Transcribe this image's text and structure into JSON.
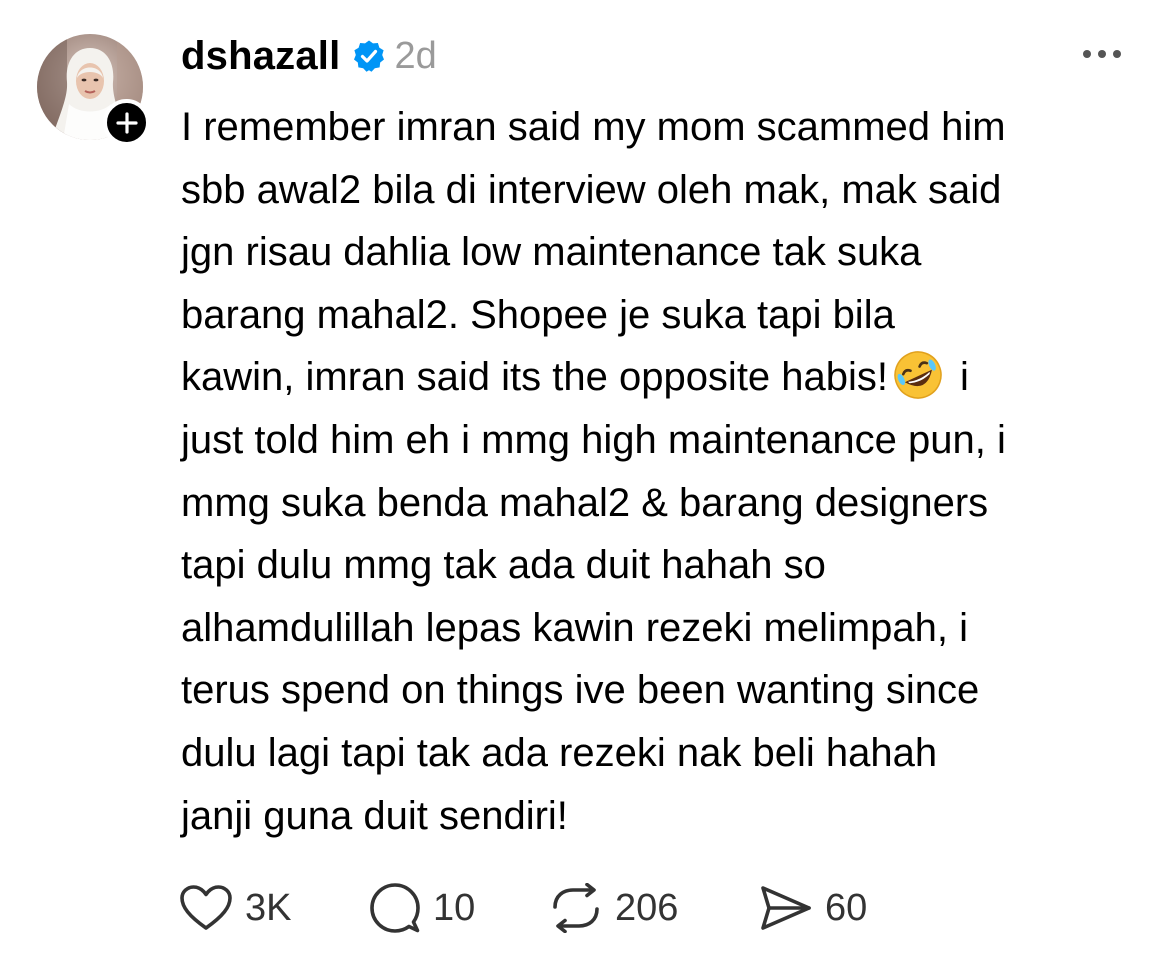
{
  "post": {
    "username": "dshazall",
    "time": "2d",
    "more_icon": "more-horizontal-icon",
    "verified_icon": "verified-badge-icon",
    "follow_icon": "plus-icon",
    "body_lines": [
      "I remember imran said my mom scammed him",
      "sbb awal2 bila di interview oleh mak, mak said",
      "jgn risau dahlia low maintenance tak suka",
      "barang mahal2. Shopee je suka tapi bila",
      "kawin, imran said its the opposite habis!",
      "i",
      "just told him eh i mmg high maintenance pun, i",
      "mmg suka benda mahal2 & barang designers",
      "tapi dulu mmg tak ada duit hahah so",
      "alhamdulillah lepas kawin rezeki melimpah, i",
      "terus spend on things ive been wanting since",
      "dulu lagi tapi tak ada rezeki nak beli hahah",
      "janji guna duit sendiri!"
    ],
    "emoji": "rolling-on-the-floor-laughing",
    "accent_color": "#0095f6"
  },
  "actions": {
    "like": {
      "icon": "heart-icon",
      "count": "3K"
    },
    "reply": {
      "icon": "comment-icon",
      "count": "10"
    },
    "repost": {
      "icon": "repost-icon",
      "count": "206"
    },
    "share": {
      "icon": "send-icon",
      "count": "60"
    }
  }
}
